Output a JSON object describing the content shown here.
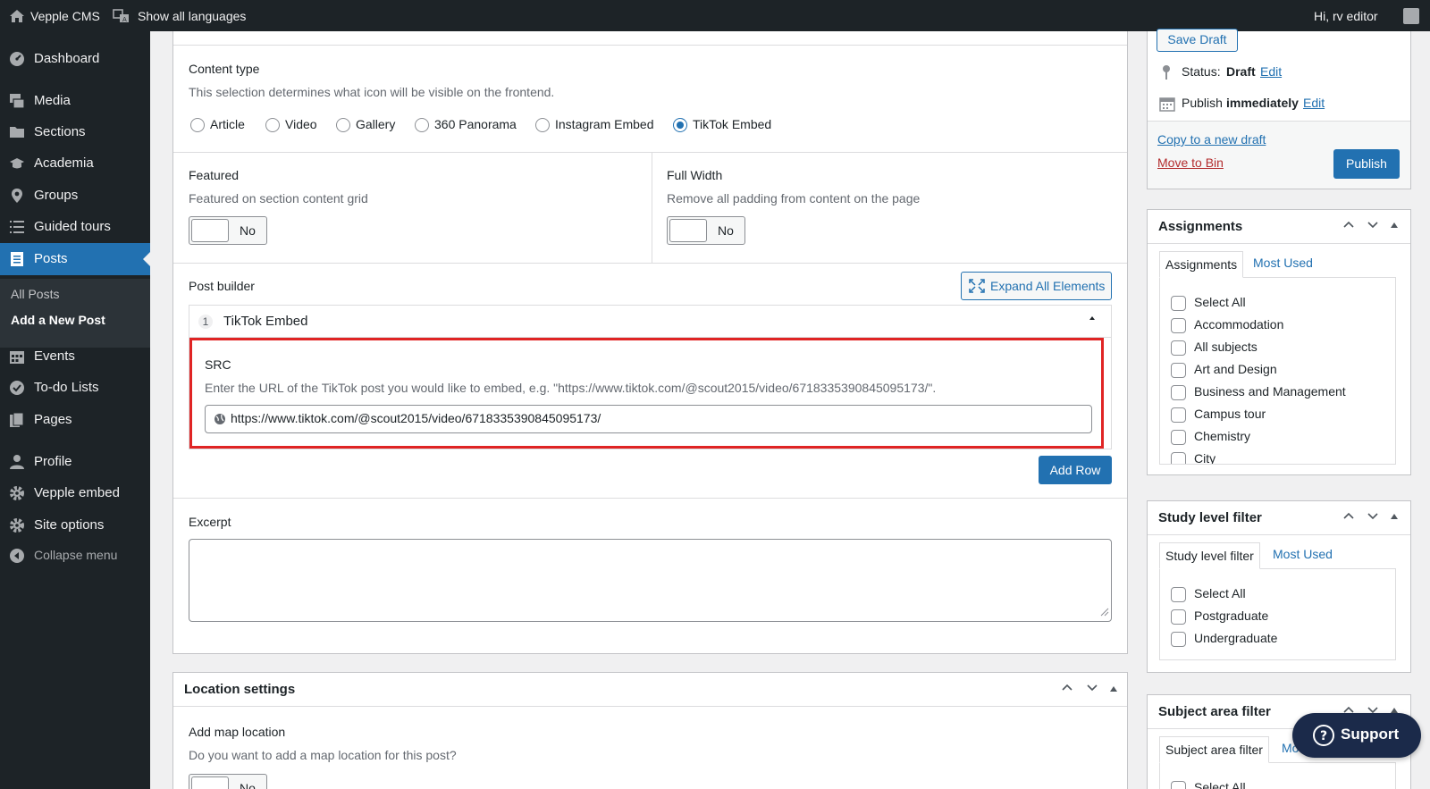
{
  "adminbar": {
    "site_name": "Vepple CMS",
    "languages": "Show all languages",
    "greeting": "Hi, rv editor"
  },
  "sidebar": {
    "items": [
      {
        "label": "Dashboard",
        "icon": "dashboard-icon"
      },
      {
        "label": "Media",
        "icon": "media-icon"
      },
      {
        "label": "Sections",
        "icon": "folder-icon"
      },
      {
        "label": "Academia",
        "icon": "graduation-cap-icon"
      },
      {
        "label": "Groups",
        "icon": "location-pin-icon"
      },
      {
        "label": "Guided tours",
        "icon": "list-icon"
      },
      {
        "label": "Posts",
        "icon": "document-icon"
      },
      {
        "label": "Events",
        "icon": "calendar-icon"
      },
      {
        "label": "To-do Lists",
        "icon": "check-circle-icon"
      },
      {
        "label": "Pages",
        "icon": "pages-icon"
      },
      {
        "label": "Profile",
        "icon": "user-icon"
      },
      {
        "label": "Vepple embed",
        "icon": "gear-icon"
      },
      {
        "label": "Site options",
        "icon": "gear-icon"
      },
      {
        "label": "Collapse menu",
        "icon": "collapse-icon"
      }
    ],
    "submenu": [
      "All Posts",
      "Add a New Post"
    ]
  },
  "content_type": {
    "label": "Content type",
    "description": "This selection determines what icon will be visible on the frontend.",
    "options": [
      "Article",
      "Video",
      "Gallery",
      "360 Panorama",
      "Instagram Embed",
      "TikTok Embed"
    ],
    "selected": "TikTok Embed"
  },
  "featured": {
    "label": "Featured",
    "description": "Featured on section content grid",
    "value": "No"
  },
  "full_width": {
    "label": "Full Width",
    "description": "Remove all padding from content on the page",
    "value": "No"
  },
  "post_builder": {
    "label": "Post builder",
    "expand_button": "Expand All Elements",
    "row_number": "1",
    "row_title": "TikTok Embed",
    "src_label": "SRC",
    "src_description": "Enter the URL of the TikTok post you would like to embed, e.g. \"https://www.tiktok.com/@scout2015/video/6718335390845095173/\".",
    "src_value": "https://www.tiktok.com/@scout2015/video/6718335390845095173/",
    "add_row": "Add Row",
    "highlight_color": "#e02424"
  },
  "excerpt": {
    "label": "Excerpt",
    "value": ""
  },
  "location": {
    "title": "Location settings",
    "map_label": "Add map location",
    "map_description": "Do you want to add a map location for this post?",
    "map_value": "No"
  },
  "publish": {
    "save_draft": "Save Draft",
    "status_label": "Status:",
    "status_value": "Draft",
    "edit": "Edit",
    "publish_label": "Publish",
    "publish_value": "immediately",
    "copy_draft": "Copy to a new draft",
    "move_to_bin": "Move to Bin",
    "publish_button": "Publish"
  },
  "assignments": {
    "title": "Assignments",
    "tab_active": "Assignments",
    "tab_other": "Most Used",
    "items": [
      "Select All",
      "Accommodation",
      "All subjects",
      "Art and Design",
      "Business and Management",
      "Campus tour",
      "Chemistry",
      "City"
    ]
  },
  "study_level": {
    "title": "Study level filter",
    "tab_active": "Study level filter",
    "tab_other": "Most Used",
    "items": [
      "Select All",
      "Postgraduate",
      "Undergraduate"
    ]
  },
  "subject_area": {
    "title": "Subject area filter",
    "tab_active": "Subject area filter",
    "tab_other": "Most Used",
    "items": [
      "Select All"
    ]
  },
  "support": {
    "label": "Support"
  },
  "colors": {
    "accent": "#2271b1",
    "sidebar_bg": "#1d2327",
    "bin_red": "#b32d2e"
  }
}
